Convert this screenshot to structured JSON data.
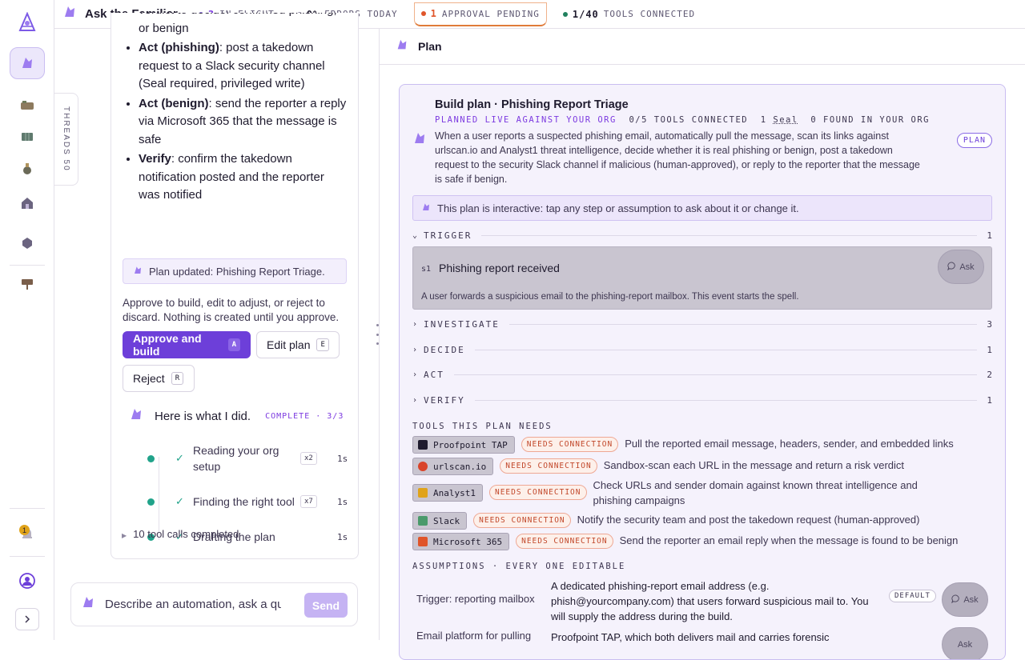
{
  "app": {
    "title": "Ask the Familiar"
  },
  "stats": [
    {
      "value": "3",
      "label": "IN FLIGHT",
      "color": "#7c3ae0"
    },
    {
      "value": "0%",
      "label": "ERRORS TODAY",
      "color": "#8d87a0"
    },
    {
      "value": "1",
      "label": "APPROVAL PENDING",
      "color": "#e0552a"
    },
    {
      "value": "1/40",
      "label": "TOOLS CONNECTED",
      "color": "#21805e"
    }
  ],
  "rail": {
    "threads_label": "THREADS 50",
    "notif_count": "1"
  },
  "chat": {
    "bullets": [
      {
        "head": "",
        "text": "verdict to decide: confirmed phishing, or benign"
      },
      {
        "head": "Act (phishing)",
        "text": ": post a takedown request to a Slack security channel (Seal required, privileged write)"
      },
      {
        "head": "Act (benign)",
        "text": ": send the reporter a reply via Microsoft 365 that the message is safe"
      },
      {
        "head": "Verify",
        "text": ": confirm the takedown notification posted and the reporter was notified"
      }
    ],
    "plan_updated": "Plan updated: Phishing Report Triage.",
    "approve_text": "Approve to build, edit to adjust, or reject to discard. Nothing is created until you approve.",
    "buttons": {
      "approve": "Approve and build",
      "approve_key": "A",
      "edit": "Edit plan",
      "edit_key": "E",
      "reject": "Reject",
      "reject_key": "R"
    },
    "did": {
      "title": "Here is what I did.",
      "status": "COMPLETE · 3/3"
    },
    "steps": [
      {
        "label": "Reading your org setup",
        "count": "x2",
        "time": "1s"
      },
      {
        "label": "Finding the right tool",
        "count": "x7",
        "time": "1s"
      },
      {
        "label": "Drafting the plan",
        "count": "",
        "time": "1s"
      }
    ],
    "tool_calls": "10 tool calls completed"
  },
  "composer": {
    "placeholder": "Describe an automation, ask a question...",
    "send": "Send"
  },
  "plan": {
    "header": "Plan",
    "title": "Build plan · Phishing Report Triage",
    "live": "PLANNED LIVE AGAINST YOUR ORG",
    "tools_connected": "0/5 TOOLS CONNECTED",
    "seal_count": "1",
    "seal": "Seal",
    "found": "0 FOUND IN YOUR ORG",
    "badge": "PLAN",
    "description": "When a user reports a suspected phishing email, automatically pull the message, scan its links against urlscan.io and Analyst1 threat intelligence, decide whether it is real phishing or benign, post a takedown request to the security Slack channel if malicious (human-approved), or reply to the reporter that the message is safe if benign.",
    "interactive_note": "This plan is interactive: tap any step or assumption to ask about it or change it.",
    "sections": [
      {
        "name": "TRIGGER",
        "count": "1"
      },
      {
        "name": "INVESTIGATE",
        "count": "3"
      },
      {
        "name": "DECIDE",
        "count": "1"
      },
      {
        "name": "ACT",
        "count": "2"
      },
      {
        "name": "VERIFY",
        "count": "1"
      }
    ],
    "trigger_step": {
      "id": "s1",
      "title": "Phishing report received",
      "desc": "A user forwards a suspicious email to the phishing-report mailbox. This event starts the spell.",
      "ask": "Ask"
    },
    "tools_heading": "TOOLS THIS PLAN NEEDS",
    "needs_label": "NEEDS CONNECTION",
    "tools": [
      {
        "name": "Proofpoint TAP",
        "icon": "proofpoint-icon",
        "color": "#1f1b2e",
        "desc": "Pull the reported email message, headers, sender, and embedded links"
      },
      {
        "name": "urlscan.io",
        "icon": "urlscan-icon",
        "color": "#d9442a",
        "desc": "Sandbox-scan each URL in the message and return a risk verdict"
      },
      {
        "name": "Analyst1",
        "icon": "analyst1-icon",
        "color": "#e0a31a",
        "desc": "Check URLs and sender domain against known threat intelligence and phishing campaigns"
      },
      {
        "name": "Slack",
        "icon": "slack-icon",
        "color": "#4a9a6b",
        "desc": "Notify the security team and post the takedown request (human-approved)"
      },
      {
        "name": "Microsoft 365",
        "icon": "microsoft365-icon",
        "color": "#e0552a",
        "desc": "Send the reporter an email reply when the message is found to be benign"
      }
    ],
    "assumptions_heading": "ASSUMPTIONS · EVERY ONE EDITABLE",
    "assumptions": [
      {
        "key": "Trigger: reporting mailbox",
        "value": "A dedicated phishing-report email address (e.g. phish@yourcompany.com) that users forward suspicious mail to. You will supply the address during the build.",
        "tag": "DEFAULT",
        "ask": "Ask"
      },
      {
        "key": "Email platform for pulling",
        "value": "Proofpoint TAP, which both delivers mail and carries forensic",
        "tag": "",
        "ask": "Ask"
      }
    ]
  }
}
